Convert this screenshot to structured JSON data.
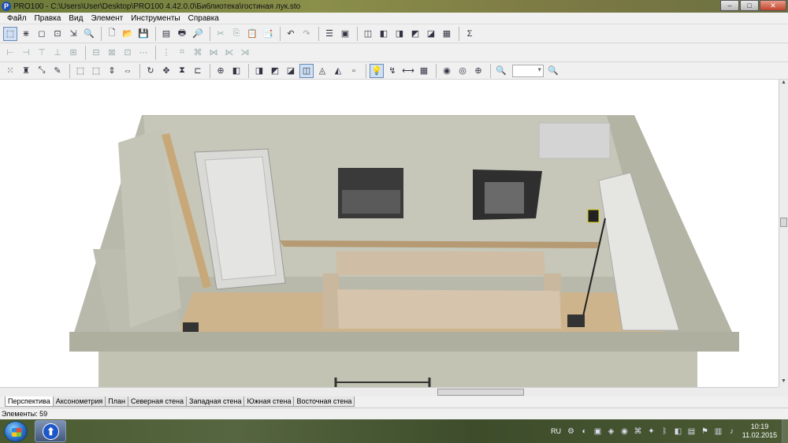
{
  "window": {
    "title": "PRO100 - C:\\Users\\User\\Desktop\\PRO100 4.42.0.0\\Библиотека\\гостиная лук.sto",
    "app_icon": "pro100-app-icon",
    "controls": {
      "minimize": "–",
      "maximize": "□",
      "close": "✕"
    }
  },
  "menu": [
    "Файл",
    "Правка",
    "Вид",
    "Элемент",
    "Инструменты",
    "Справка"
  ],
  "toolbar1": {
    "icons": [
      "select-arrow-icon",
      "grid-icon",
      "rotate-icon",
      "node-icon",
      "move-icon",
      "zoom-icon",
      "new-file-icon",
      "open-folder-icon",
      "save-icon",
      "print-preview-icon",
      "print-icon",
      "preview-page-icon",
      "cut-icon",
      "copy-icon",
      "paste-icon",
      "paste-special-icon",
      "undo-icon",
      "redo-icon",
      "properties-icon",
      "dialog-icon",
      "view1-icon",
      "view2-icon",
      "view3-icon",
      "view4-icon",
      "view5-icon",
      "report-icon",
      "sum-icon"
    ],
    "glyphs": [
      "⬚",
      "⋇",
      "◻",
      "⊡",
      "⇲",
      "🔍",
      "🗋",
      "📂",
      "💾",
      "▤",
      "🖶",
      "🔎",
      "✂",
      "⎘",
      "📋",
      "📑",
      "↶",
      "↷",
      "☰",
      "▣",
      "◫",
      "◧",
      "◨",
      "◩",
      "◪",
      "▦",
      "Σ"
    ]
  },
  "toolbar2": {
    "glyphs": [
      "⊢",
      "⊣",
      "⊤",
      "⊥",
      "⊞",
      "⊟",
      "⊠",
      "⊡",
      "⋯",
      "⋮",
      "⌗",
      "⌘",
      "⋈",
      "⋉",
      "⋊"
    ]
  },
  "toolbar3": {
    "glyphs": [
      "⁙",
      "♜",
      "⤡",
      "✎",
      "⬚",
      "⬚",
      "⇕",
      "⇔",
      "↻",
      "✥",
      "⧗",
      "⊏",
      "⊕",
      "◧",
      "◨",
      "◩",
      "◪",
      "◫",
      "◬",
      "◭",
      "▫",
      "💡",
      "↯",
      "⟷",
      "▦",
      "◉",
      "◎",
      "⊕",
      "🔍",
      "🔍"
    ],
    "zoom_value": ""
  },
  "tabs": [
    "Перспектива",
    "Аксонометрия",
    "План",
    "Северная стена",
    "Западная стена",
    "Южная стена",
    "Восточная стена"
  ],
  "active_tab": 0,
  "status": "Элементы: 59",
  "taskbar": {
    "lang": "RU",
    "time": "10:19",
    "date": "11.02.2015"
  },
  "colors": {
    "wall": "#c6c7b8",
    "floor": "#cdb48c",
    "sofa": "#d6c4ad"
  }
}
